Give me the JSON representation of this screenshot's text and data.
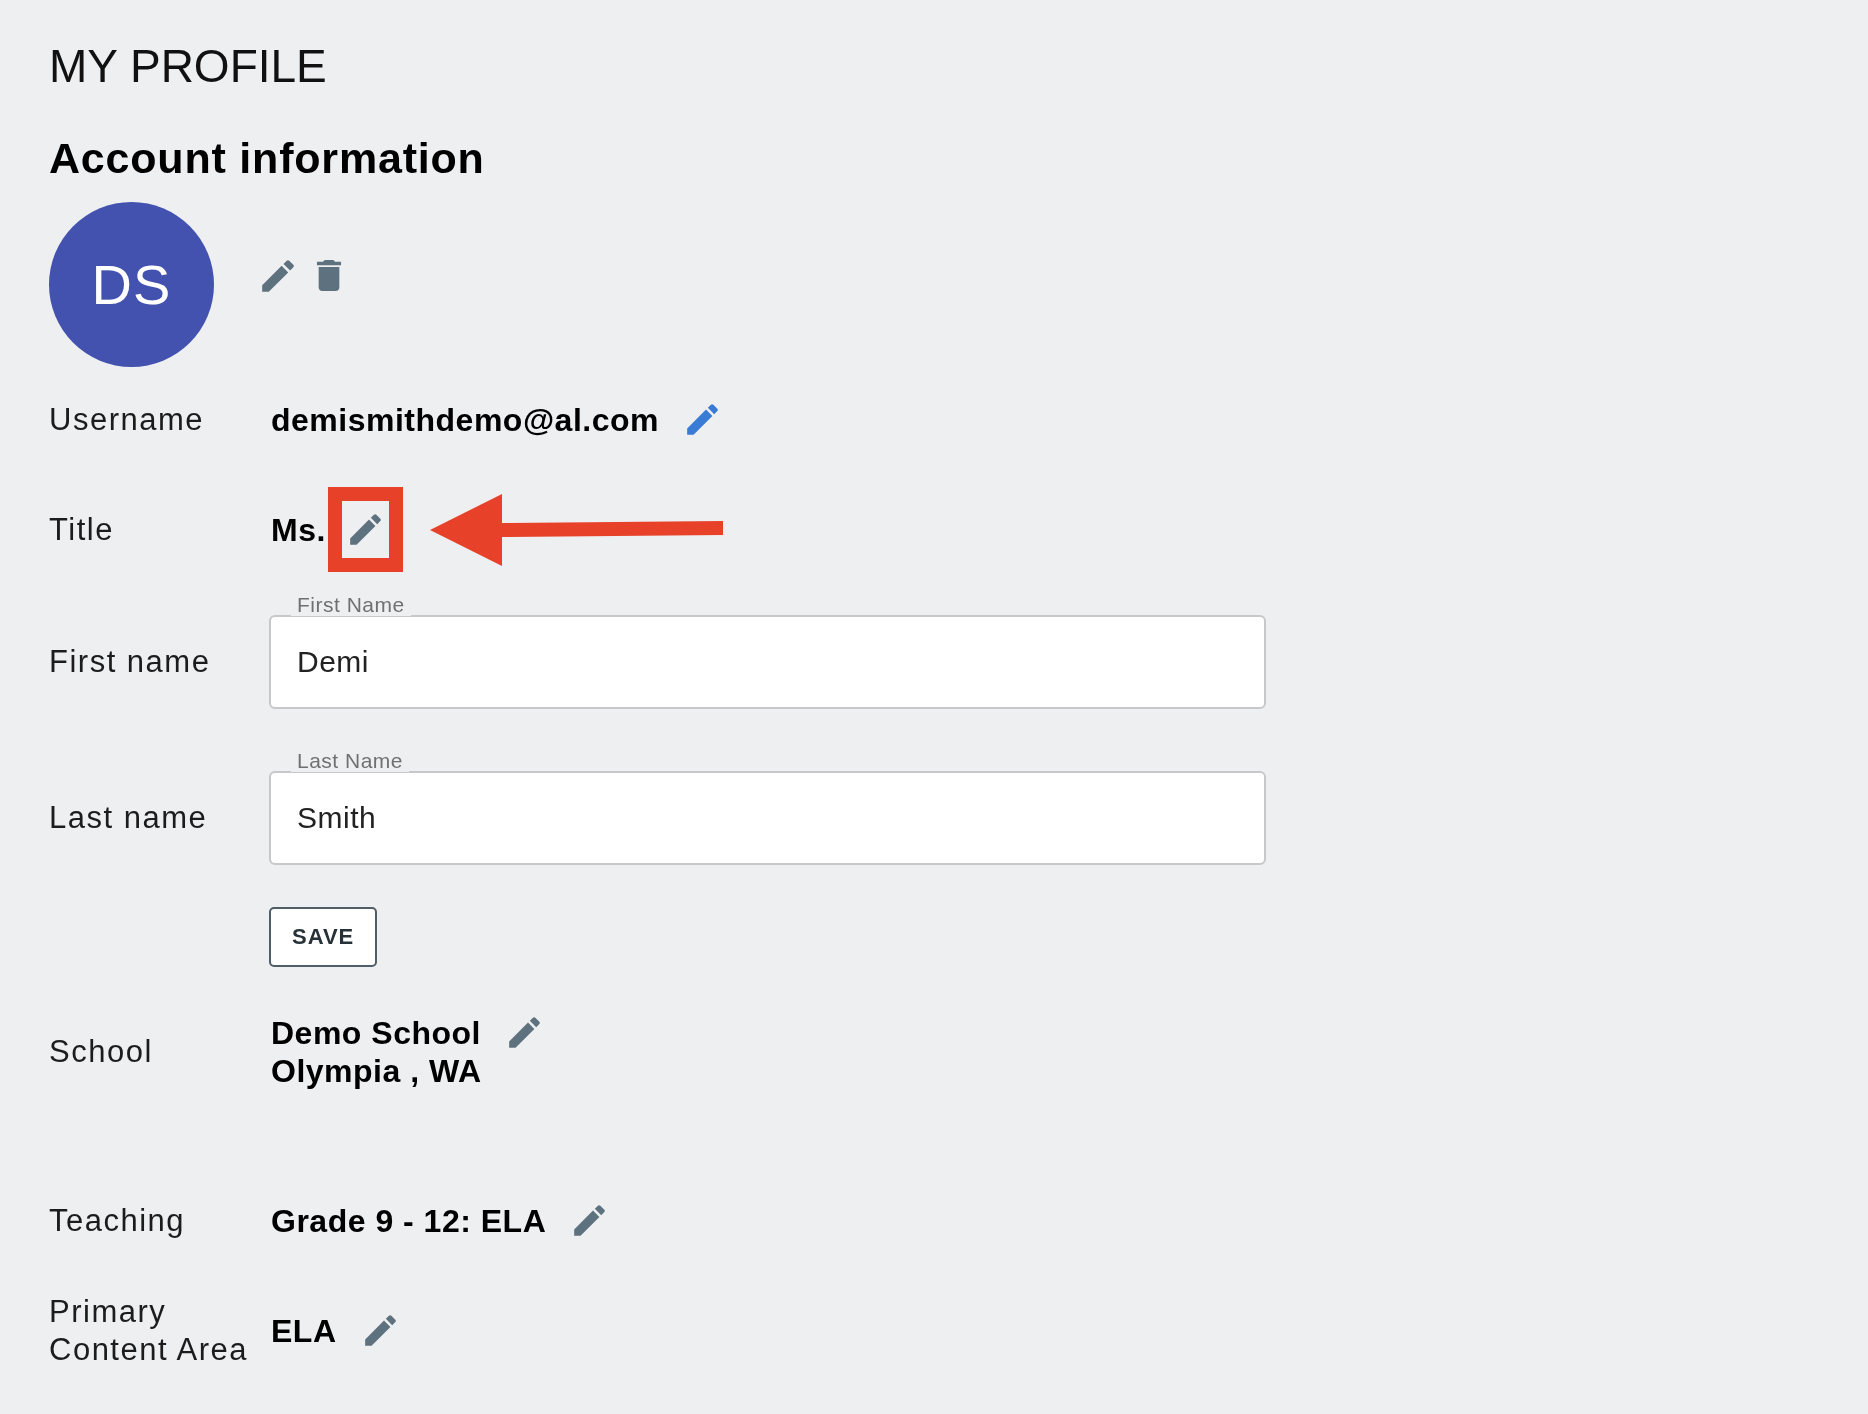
{
  "page_title": "MY PROFILE",
  "section": {
    "heading": "Account information",
    "avatar": {
      "initials": "DS"
    },
    "fields": [
      {
        "kind": "text",
        "label": "Username",
        "lines": [
          "demismithdemo@al.com"
        ],
        "color": "#3a7bd5",
        "highlighted": false
      },
      {
        "kind": "text",
        "label": "Title",
        "lines": [
          "Ms."
        ],
        "color": "#5e717e",
        "highlighted": true
      },
      {
        "kind": "input",
        "label": "First name",
        "field_label": "First Name",
        "value": "Demi"
      },
      {
        "kind": "input",
        "label": "Last name",
        "field_label": "Last Name",
        "value": "Smith"
      },
      {
        "kind": "button",
        "label": "SAVE"
      },
      {
        "kind": "text",
        "label": "School",
        "lines": [
          "Demo School",
          "Olympia , WA"
        ],
        "color": "#5e717e",
        "highlighted": false
      },
      {
        "kind": "text",
        "label": "Teaching",
        "lines": [
          "Grade 9 - 12: ELA"
        ],
        "color": "#5e717e",
        "highlighted": false
      },
      {
        "kind": "text",
        "label": "Primary Content Area",
        "lines": [
          "ELA"
        ],
        "color": "#5e717e",
        "highlighted": false
      }
    ]
  }
}
